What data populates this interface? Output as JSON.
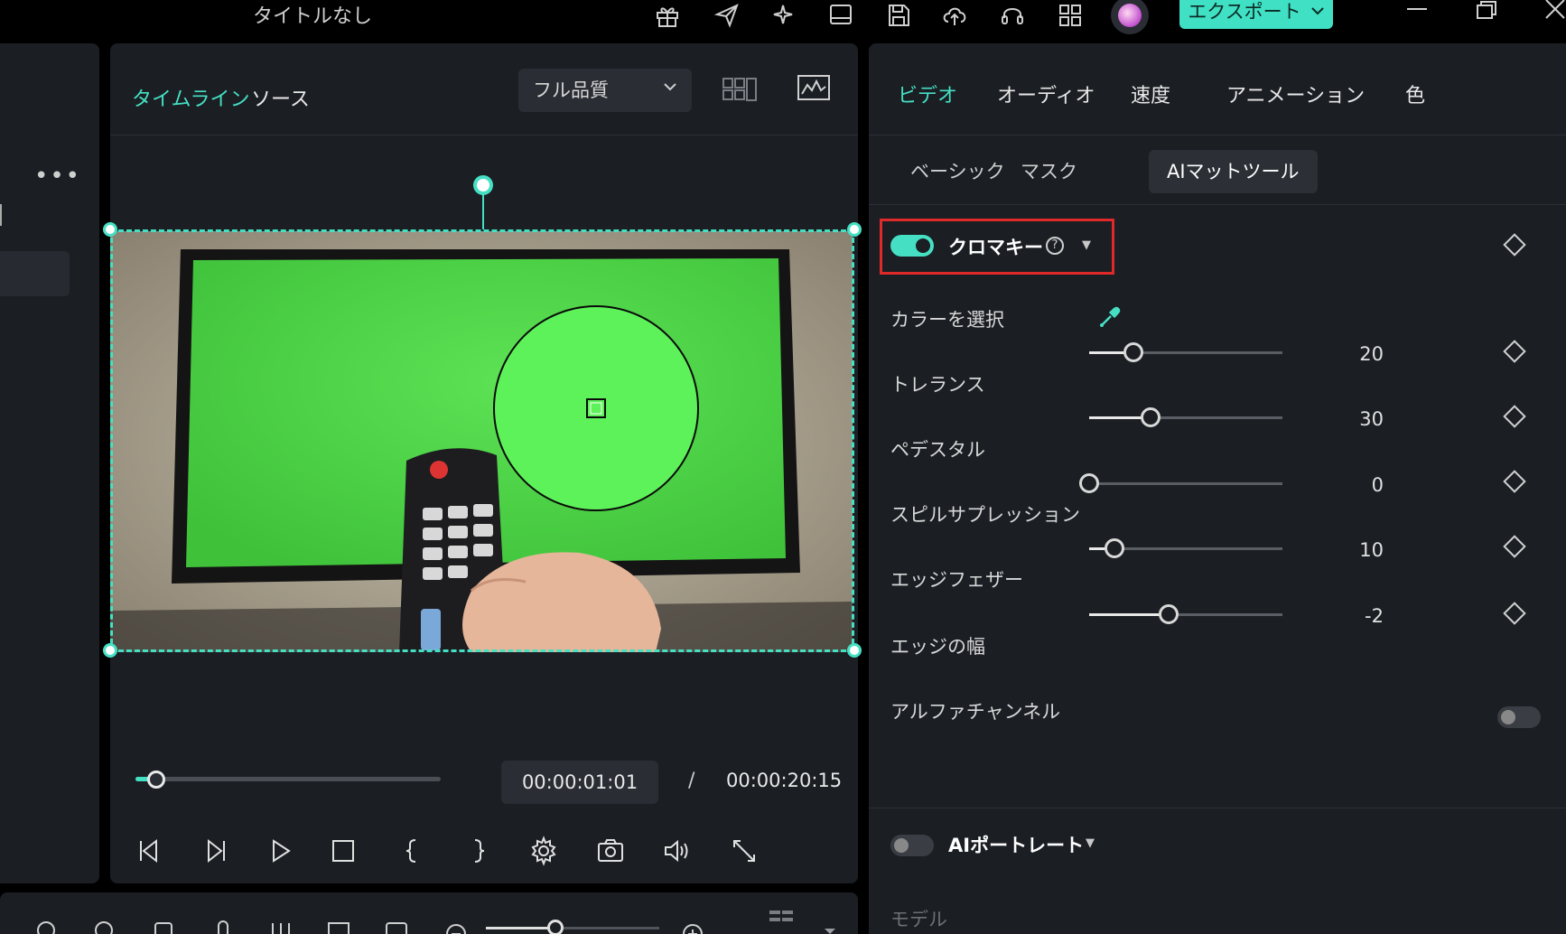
{
  "window": {
    "title": "タイトルなし",
    "export_label": "エクスポート"
  },
  "player": {
    "tabs": [
      "タイムライン",
      "ソース"
    ],
    "quality": "フル品質",
    "current_time": "00:00:01:01",
    "separator": "/",
    "total_time": "00:00:20:15",
    "playback_progress": 0.07
  },
  "inspector": {
    "tabs": [
      "ビデオ",
      "オーディオ",
      "速度",
      "アニメーション",
      "色"
    ],
    "subtabs": [
      "ベーシック",
      "マスク",
      "AIマットツール"
    ],
    "chroma_key": {
      "title": "クロマキー",
      "enabled": true,
      "help": "?"
    },
    "select_color_label": "カラーを選択",
    "properties": [
      {
        "label": "トレランス",
        "value": "20",
        "level": 0.23
      },
      {
        "label": "ペデスタル",
        "value": "30",
        "level": 0.32
      },
      {
        "label": "スピルサプレッション",
        "value": "0",
        "level": 0.0
      },
      {
        "label": "エッジフェザー",
        "value": "10",
        "level": 0.13
      },
      {
        "label": "エッジの幅",
        "value": "-2",
        "level": 0.41
      }
    ],
    "alpha_channel": {
      "label": "アルファチャンネル",
      "enabled": false
    },
    "ai_portrait": {
      "title": "AIポートレート",
      "enabled": false
    },
    "model_label": "モデル"
  },
  "colors": {
    "accent": "#45e0c4",
    "highlight_box": "#e02a2a",
    "panel": "#1b1e23"
  }
}
